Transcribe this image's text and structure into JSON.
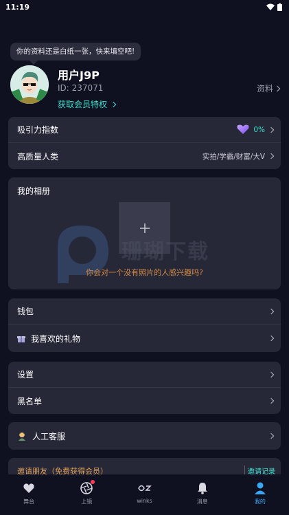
{
  "status_bar": {
    "time": "11:19"
  },
  "tooltip": {
    "text": "你的资料还是白纸一张，快来填空吧!"
  },
  "profile": {
    "name": "用户J9P",
    "id": "ID: 237071",
    "vip_link": "获取会员特权",
    "profile_link": "资料"
  },
  "attraction": {
    "label": "吸引力指数",
    "value": "0%"
  },
  "quality": {
    "label": "高质量人类",
    "value": "实拍/学霸/财富/大V"
  },
  "album": {
    "title": "我的相册",
    "hint": "你会对一个没有照片的人感兴趣吗?",
    "watermark": "珊瑚下载"
  },
  "wallet": {
    "label": "钱包"
  },
  "gifts": {
    "label": "我喜欢的礼物"
  },
  "settings": {
    "label": "设置"
  },
  "blacklist": {
    "label": "黑名单"
  },
  "support": {
    "label": "人工客服"
  },
  "invite": {
    "label": "邀请朋友（免费获得会员）",
    "record": "邀请记录"
  },
  "tabs": [
    {
      "label": "舞台",
      "icon": "heart-icon"
    },
    {
      "label": "上镜",
      "icon": "camera-aperture-icon"
    },
    {
      "label": "winks",
      "icon": "winks-icon"
    },
    {
      "label": "消息",
      "icon": "bell-icon"
    },
    {
      "label": "我的",
      "icon": "person-icon"
    }
  ],
  "colors": {
    "background": "#0f1020",
    "card": "#262838",
    "accent_teal": "#3de0cf",
    "accent_orange": "#d48a44",
    "active_tab": "#3aa7f5"
  }
}
